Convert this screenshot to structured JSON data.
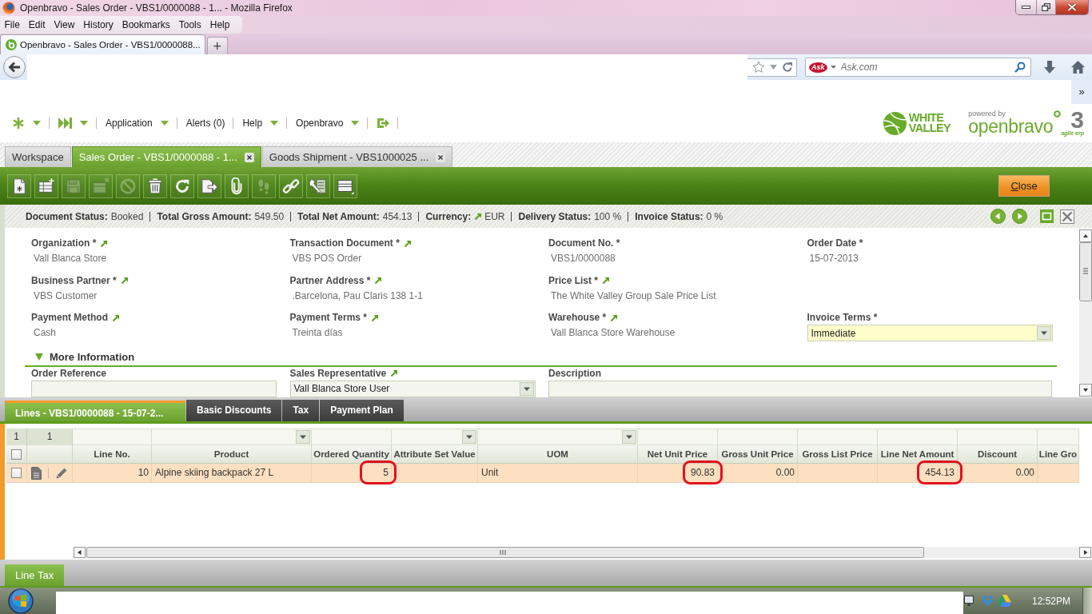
{
  "browser": {
    "title": "Openbravo - Sales Order - VBS1/0000088 - 1... - Mozilla Firefox",
    "menu": [
      "File",
      "Edit",
      "View",
      "History",
      "Bookmarks",
      "Tools",
      "Help"
    ],
    "tabs": [
      {
        "label": "Openbravo - Sales Order - VBS1/0000088...",
        "selected": true
      }
    ],
    "new_tab": "+",
    "search": {
      "engine": "Ask",
      "placeholder": "Ask.com"
    },
    "bookmarks_overflow": "»"
  },
  "app_menu": [
    {
      "label": "Application",
      "dropdown": true
    },
    {
      "label": "Alerts (0)",
      "dropdown": false
    },
    {
      "label": "Help",
      "dropdown": true
    },
    {
      "label": "Openbravo",
      "dropdown": true
    }
  ],
  "logos": {
    "client": [
      "WHITE",
      "VALLEY"
    ],
    "vendor": {
      "tagline": "powered by",
      "name": "openbravo",
      "version": "3",
      "slogan": "agile erp"
    }
  },
  "window_tabs": [
    {
      "label": "Workspace",
      "selected": false,
      "closable": false
    },
    {
      "label": "Sales Order - VBS1/0000088 - 1...",
      "selected": true,
      "closable": true
    },
    {
      "label": "Goods Shipment - VBS1000025 ...",
      "selected": false,
      "closable": true
    }
  ],
  "toolbar": {
    "buttons": [
      {
        "kind": "new",
        "disabled": false
      },
      {
        "kind": "newrow",
        "disabled": false
      },
      {
        "kind": "save",
        "disabled": true
      },
      {
        "kind": "undo",
        "disabled": true
      },
      {
        "kind": "cancel",
        "disabled": true
      },
      {
        "kind": "delete",
        "disabled": false
      },
      {
        "kind": "refresh",
        "disabled": false
      },
      {
        "kind": "export",
        "disabled": false
      },
      {
        "kind": "attach",
        "disabled": false
      },
      {
        "kind": "audit",
        "disabled": true
      },
      {
        "kind": "link",
        "disabled": false
      },
      {
        "kind": "tools",
        "disabled": false
      },
      {
        "kind": "layout",
        "disabled": false
      }
    ],
    "close": "Close"
  },
  "status_bar": [
    {
      "label": "Document Status:",
      "value": "Booked",
      "link": false
    },
    {
      "label": "Total Gross Amount:",
      "value": "549.50",
      "link": false
    },
    {
      "label": "Total Net Amount:",
      "value": "454.13",
      "link": false
    },
    {
      "label": "Currency:",
      "value": "EUR",
      "link": true
    },
    {
      "label": "Delivery Status:",
      "value": "100 %",
      "link": false
    },
    {
      "label": "Invoice Status:",
      "value": "0 %",
      "link": false
    }
  ],
  "form": {
    "rows": [
      [
        {
          "label": "Organization *",
          "link": true,
          "kind": "readonly",
          "value": "Vall Blanca Store"
        },
        {
          "label": "Transaction Document *",
          "link": true,
          "kind": "readonly",
          "value": "VBS POS Order"
        },
        {
          "label": "Document No. *",
          "link": false,
          "kind": "readonly",
          "value": "VBS1/0000088"
        },
        {
          "label": "Order Date *",
          "link": false,
          "kind": "readonly",
          "value": "15-07-2013"
        }
      ],
      [
        {
          "label": "Business Partner *",
          "link": true,
          "kind": "readonly",
          "value": "VBS Customer"
        },
        {
          "label": "Partner Address *",
          "link": true,
          "kind": "readonly",
          "value": ".Barcelona, Pau Claris 138 1-1"
        },
        {
          "label": "Price List *",
          "link": true,
          "kind": "readonly",
          "value": "The White Valley Group Sale Price List"
        }
      ],
      [
        {
          "label": "Payment Method",
          "link": true,
          "kind": "readonly",
          "value": "Cash"
        },
        {
          "label": "Payment Terms *",
          "link": true,
          "kind": "readonly",
          "value": "Treinta días"
        },
        {
          "label": "Warehouse *",
          "link": true,
          "kind": "readonly",
          "value": "Vall Blanca Store Warehouse"
        },
        {
          "label": "Invoice Terms *",
          "link": false,
          "kind": "select",
          "required": true,
          "value": "Immediate"
        }
      ]
    ],
    "sections": [
      {
        "title": "More Information",
        "expanded": true,
        "rows": [
          [
            {
              "label": "Order Reference",
              "link": false,
              "kind": "text",
              "required": false
            },
            {
              "label": "Sales Representative",
              "link": true,
              "kind": "select",
              "required": false,
              "value": "Vall Blanca Store User"
            },
            {
              "label": "Description",
              "link": false,
              "kind": "textarea",
              "required": false
            }
          ]
        ]
      }
    ]
  },
  "lines": {
    "tabs": [
      {
        "label": "Lines - VBS1/0000088 - 15-07-2...",
        "selected": true
      },
      {
        "label": "Basic Discounts",
        "selected": false
      },
      {
        "label": "Tax",
        "selected": false
      },
      {
        "label": "Payment Plan",
        "selected": false
      }
    ],
    "grid": {
      "counts": [
        "1",
        "1"
      ],
      "select_all": {
        "checked": false
      },
      "columns": [
        {
          "label": "Line No.",
          "numeric": true,
          "filter_dropdown": false
        },
        {
          "label": "Product",
          "numeric": false,
          "filter_dropdown": true
        },
        {
          "label": "Ordered Quantity",
          "numeric": true,
          "filter_dropdown": false
        },
        {
          "label": "Attribute Set Value",
          "filter_dropdown": true
        },
        {
          "label": "UOM",
          "numeric": false,
          "filter_dropdown": true
        },
        {
          "label": "Net Unit Price",
          "numeric": true,
          "filter_dropdown": false
        },
        {
          "label": "Gross Unit Price",
          "numeric": true,
          "filter_dropdown": false
        },
        {
          "label": "Gross List Price",
          "filter_dropdown": false
        },
        {
          "label": "Line Net Amount",
          "numeric": true,
          "filter_dropdown": false
        },
        {
          "label": "Discount",
          "numeric": true,
          "filter_dropdown": false
        },
        {
          "label": "Line Gro",
          "filter_dropdown": false
        }
      ],
      "rows": [
        {
          "selected": true,
          "checked": false,
          "cells": [
            {
              "text": "10",
              "circled": false
            },
            {
              "text": "Alpine skiing backpack 27 L",
              "circled": false
            },
            {
              "text": "5",
              "circled": true
            },
            {
              "circled": false
            },
            {
              "text": "Unit",
              "circled": false
            },
            {
              "text": "90.83",
              "circled": true
            },
            {
              "text": "0.00",
              "circled": false
            },
            {
              "circled": false
            },
            {
              "text": "454.13",
              "circled": true
            },
            {
              "text": "0.00",
              "circled": false
            },
            {
              "circled": false
            }
          ]
        }
      ]
    }
  },
  "footer_tabs": [
    {
      "label": "Line Tax",
      "selected": true
    }
  ],
  "taskbar": {
    "time": "12:52PM"
  }
}
